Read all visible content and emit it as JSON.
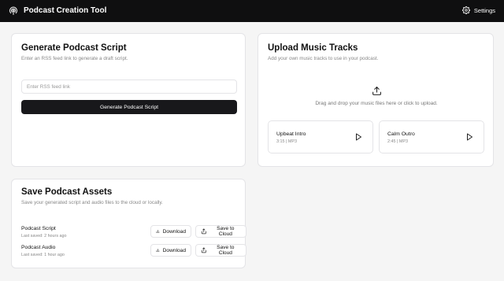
{
  "header": {
    "title": "Podcast Creation Tool",
    "settings_label": "Settings"
  },
  "generate": {
    "title": "Generate Podcast Script",
    "description": "Enter an RSS feed link to generate a draft script.",
    "input_placeholder": "Enter RSS feed link",
    "input_value": "",
    "button_label": "Generate Podcast Script"
  },
  "upload": {
    "title": "Upload Music Tracks",
    "description": "Add your own music tracks to use in your podcast.",
    "dropzone_text": "Drag and drop your music files here or click to upload.",
    "tracks": [
      {
        "name": "Upbeat Intro",
        "meta": "3:15 | MP3"
      },
      {
        "name": "Calm Outro",
        "meta": "2:45 | MP3"
      }
    ]
  },
  "save": {
    "title": "Save Podcast Assets",
    "description": "Save your generated script and audio files to the cloud or locally.",
    "assets": [
      {
        "name": "Podcast Script",
        "meta": "Last saved: 2 hours ago"
      },
      {
        "name": "Podcast Audio",
        "meta": "Last saved: 1 hour ago"
      }
    ],
    "download_label": "Download",
    "cloud_label": "Save to Cloud"
  },
  "icons": {
    "logo": "podcast-icon",
    "settings": "gear-icon",
    "upload": "upload-icon",
    "play": "play-icon",
    "download": "download-icon",
    "cloud": "share-upload-icon"
  },
  "colors": {
    "topbar": "#0f0f10",
    "primary_button": "#18181b",
    "border": "#e4e4e7",
    "background": "#f5f5f5"
  }
}
